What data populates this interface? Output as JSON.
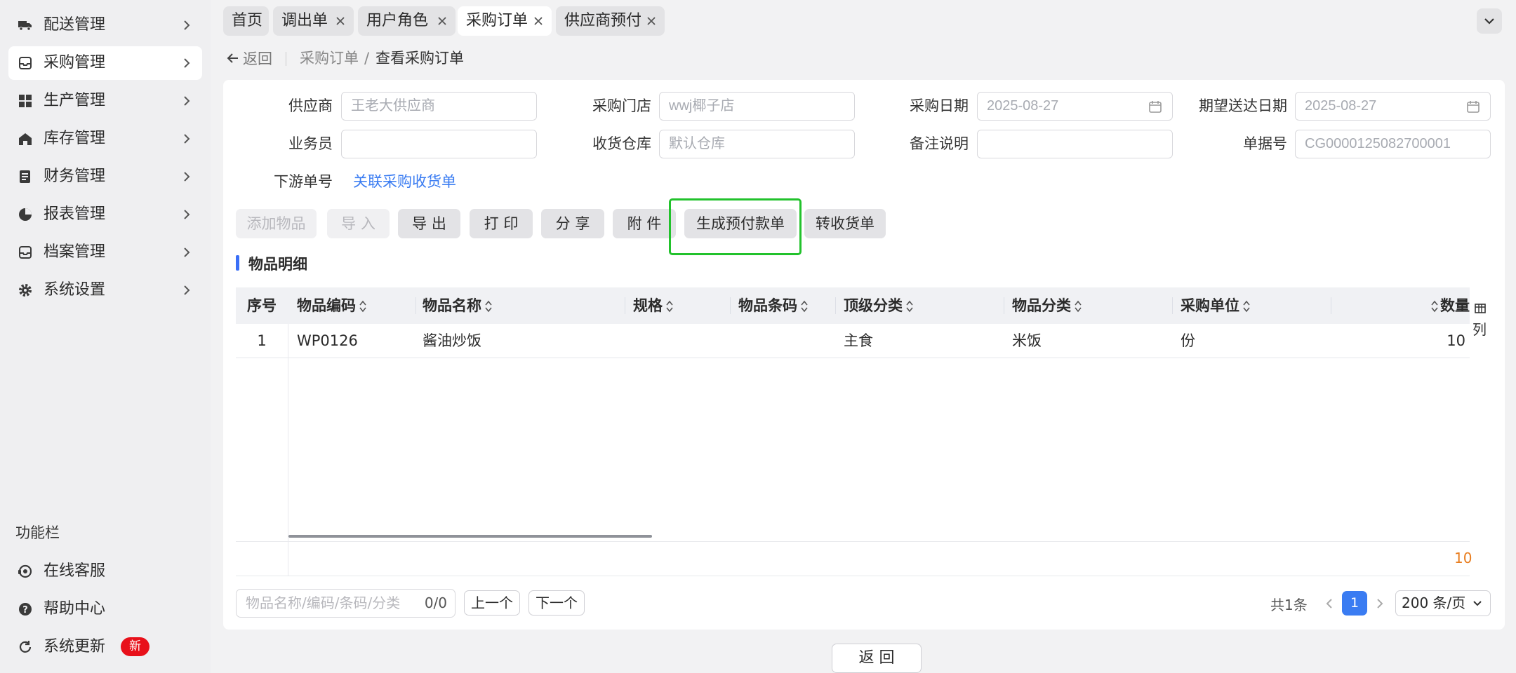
{
  "sidebar": {
    "items": [
      {
        "label": "配送管理",
        "icon": "truck-icon"
      },
      {
        "label": "采购管理",
        "icon": "tray-icon"
      },
      {
        "label": "生产管理",
        "icon": "grid-icon"
      },
      {
        "label": "库存管理",
        "icon": "home-icon"
      },
      {
        "label": "财务管理",
        "icon": "ledger-icon"
      },
      {
        "label": "报表管理",
        "icon": "pie-icon"
      },
      {
        "label": "档案管理",
        "icon": "inbox-icon"
      },
      {
        "label": "系统设置",
        "icon": "gear-icon"
      }
    ],
    "func_title": "功能栏",
    "func_items": [
      {
        "label": "在线客服",
        "icon": "headset-icon"
      },
      {
        "label": "帮助中心",
        "icon": "help-icon"
      },
      {
        "label": "系统更新",
        "icon": "refresh-icon",
        "badge": "新"
      }
    ]
  },
  "tabs": [
    {
      "label": "首页"
    },
    {
      "label": "调出单"
    },
    {
      "label": "用户角色"
    },
    {
      "label": "采购订单"
    },
    {
      "label": "供应商预付"
    }
  ],
  "nav": {
    "back": "返回",
    "crumb_parent": "采购订单",
    "crumb_sep": "/",
    "crumb_current": "查看采购订单"
  },
  "form": {
    "supplier_label": "供应商",
    "supplier_value": "王老大供应商",
    "store_label": "采购门店",
    "store_value": "wwj椰子店",
    "date_label": "采购日期",
    "date_value": "2025-08-27",
    "expect_label": "期望送达日期",
    "expect_value": "2025-08-27",
    "staff_label": "业务员",
    "staff_value": "",
    "warehouse_label": "收货仓库",
    "warehouse_value": "默认仓库",
    "remark_label": "备注说明",
    "remark_value": "",
    "docno_label": "单据号",
    "docno_value": "CG0000125082700001",
    "downstream_label": "下游单号",
    "downstream_link": "关联采购收货单"
  },
  "toolbar": {
    "add": "添加物品",
    "import": "导 入",
    "export": "导 出",
    "print": "打 印",
    "share": "分 享",
    "attach": "附 件",
    "prepay": "生成预付款单",
    "receipt": "转收货单"
  },
  "section_title": "物品明细",
  "table": {
    "headers": [
      "序号",
      "物品编码",
      "物品名称",
      "规格",
      "物品条码",
      "顶级分类",
      "物品分类",
      "采购单位",
      "数量"
    ],
    "rows": [
      {
        "seq": "1",
        "code": "WP0126",
        "name": "酱油炒饭",
        "spec": "",
        "barcode": "",
        "top_cat": "主食",
        "cat": "米饭",
        "unit": "份",
        "qty": "10"
      }
    ],
    "column_btn": "列",
    "footer_qty": "10"
  },
  "footer": {
    "search_placeholder": "物品名称/编码/条码/分类",
    "search_count": "0/0",
    "prev": "上一个",
    "next": "下一个",
    "total": "共1条",
    "current_page": "1",
    "page_size": "200 条/页"
  },
  "bottom_back": "返 回",
  "colors": {
    "accent": "#3a7cf2",
    "highlight": "#22c22c",
    "badge": "#e8101a",
    "sum": "#e87d1e"
  }
}
